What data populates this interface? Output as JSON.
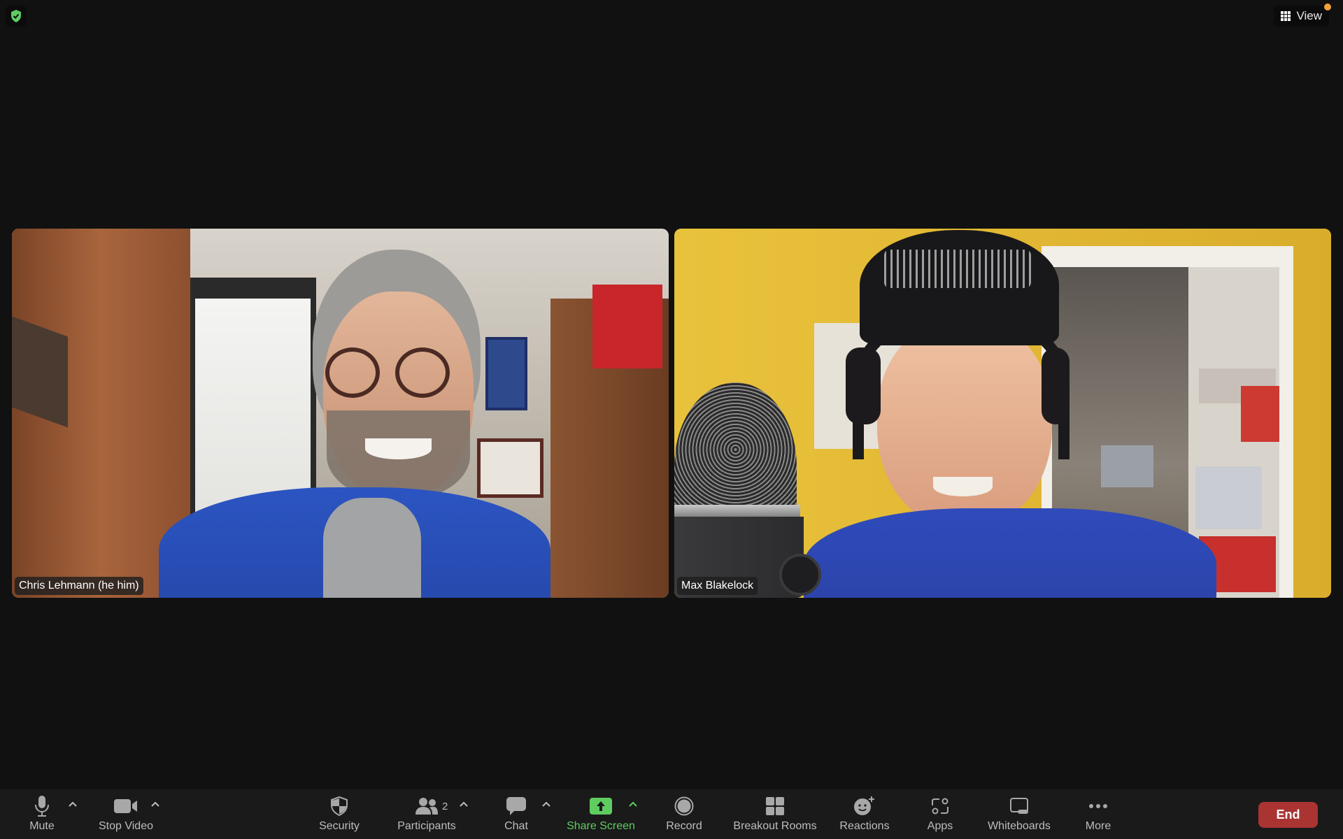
{
  "top_bar": {
    "security_badge": "shield-check-icon",
    "view_button": {
      "label": "View",
      "icon": "grid-icon",
      "notification_dot_color": "#f0a23a"
    }
  },
  "participants_video": [
    {
      "name": "Chris Lehmann (he him)"
    },
    {
      "name": "Max Blakelock"
    }
  ],
  "toolbar": {
    "items": [
      {
        "label": "Mute",
        "icon": "microphone-icon",
        "has_caret": true
      },
      {
        "label": "Stop Video",
        "icon": "video-camera-icon",
        "has_caret": true
      },
      {
        "label": "Security",
        "icon": "security-shield-icon",
        "has_caret": false
      },
      {
        "label": "Participants",
        "icon": "participants-icon",
        "count": "2",
        "has_caret": true
      },
      {
        "label": "Chat",
        "icon": "chat-bubble-icon",
        "has_caret": true
      },
      {
        "label": "Share Screen",
        "icon": "share-screen-icon",
        "has_caret": true
      },
      {
        "label": "Record",
        "icon": "record-icon",
        "has_caret": false
      },
      {
        "label": "Breakout Rooms",
        "icon": "breakout-rooms-icon",
        "has_caret": false
      },
      {
        "label": "Reactions",
        "icon": "reactions-icon",
        "has_caret": false
      },
      {
        "label": "Apps",
        "icon": "apps-icon",
        "has_caret": false
      },
      {
        "label": "Whiteboards",
        "icon": "whiteboard-icon",
        "has_caret": false
      },
      {
        "label": "More",
        "icon": "more-dots-icon",
        "has_caret": false
      }
    ],
    "end_button": {
      "label": "End",
      "color": "#a93432"
    },
    "share_accent_color": "#5fcc5f"
  }
}
